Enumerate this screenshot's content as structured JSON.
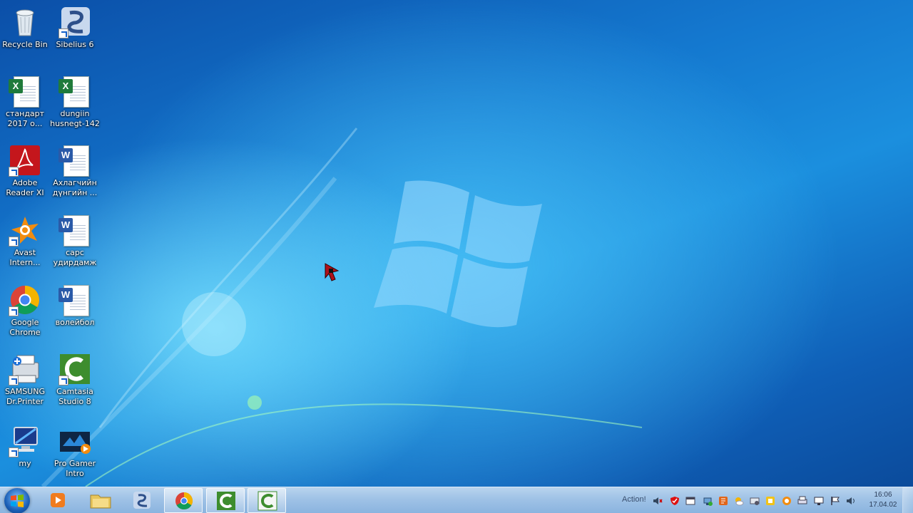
{
  "desktop": {
    "icons": [
      {
        "name": "recycle-bin",
        "label": "Recycle Bin",
        "icon": "recycle-bin-icon"
      },
      {
        "name": "sibelius",
        "label": "Sibelius 6",
        "icon": "sibelius-icon"
      },
      {
        "name": "excel-standart",
        "label": "стандарт\n2017 о...",
        "icon": "excel-file-icon"
      },
      {
        "name": "excel-dungiin",
        "label": "dungiin\nhusnegt-142",
        "icon": "excel-file-icon"
      },
      {
        "name": "adobe-reader",
        "label": "Adobe\nReader XI",
        "icon": "adobe-reader-icon"
      },
      {
        "name": "word-akhlagchiin",
        "label": "Ахлагчийн\nдүнгийн ...",
        "icon": "word-file-icon"
      },
      {
        "name": "avast",
        "label": "Avast\nIntern...",
        "icon": "avast-icon"
      },
      {
        "name": "word-sars",
        "label": "сарс\nудирдамж",
        "icon": "word-file-icon"
      },
      {
        "name": "google-chrome",
        "label": "Google\nChrome",
        "icon": "chrome-icon"
      },
      {
        "name": "word-voleibol",
        "label": "волейбол",
        "icon": "word-file-icon"
      },
      {
        "name": "samsung-printer",
        "label": "SAMSUNG\nDr.Printer",
        "icon": "printer-icon"
      },
      {
        "name": "camtasia",
        "label": "Camtasia\nStudio 8",
        "icon": "camtasia-icon"
      },
      {
        "name": "my-computer",
        "label": "my",
        "icon": "computer-icon"
      },
      {
        "name": "pro-gamer-intro",
        "label": "Pro Gamer\nIntro",
        "icon": "video-file-icon"
      }
    ]
  },
  "taskbar": {
    "start_icon": "windows-logo-icon",
    "pinned": [
      {
        "name": "media-player",
        "icon": "media-player-icon"
      },
      {
        "name": "explorer",
        "icon": "folder-icon"
      },
      {
        "name": "sibelius",
        "icon": "sibelius-icon"
      },
      {
        "name": "chrome",
        "icon": "chrome-icon"
      },
      {
        "name": "camtasia-studio",
        "icon": "camtasia-icon"
      },
      {
        "name": "camtasia-recorder",
        "icon": "camtasia-icon"
      }
    ],
    "tray_label": "Action!",
    "tray_icons": [
      "volume-muted-icon",
      "shield-icon",
      "window-icon",
      "network-icon",
      "app-icon",
      "weather-icon",
      "settings-icon",
      "tray-app-icon",
      "avast-tray-icon",
      "printer-tray-icon",
      "monitor-icon",
      "flag-icon",
      "volume-icon"
    ],
    "clock": {
      "time": "16:06",
      "date": "17.04.02"
    }
  },
  "colors": {
    "wallpaper": "#1b8fde",
    "taskbar": "#a8c8ea"
  }
}
